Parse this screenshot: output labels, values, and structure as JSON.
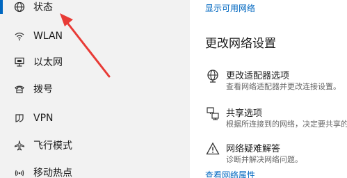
{
  "sidebar": {
    "items": [
      {
        "label": "状态",
        "icon": "globe-icon",
        "active": true
      },
      {
        "label": "WLAN",
        "icon": "wifi-icon"
      },
      {
        "label": "以太网",
        "icon": "ethernet-icon"
      },
      {
        "label": "拨号",
        "icon": "dialup-icon"
      },
      {
        "label": "VPN",
        "icon": "vpn-icon"
      },
      {
        "label": "飞行模式",
        "icon": "airplane-icon"
      },
      {
        "label": "移动热点",
        "icon": "hotspot-icon"
      }
    ]
  },
  "main": {
    "top_link": "显示可用网络",
    "section_title": "更改网络设置",
    "options": [
      {
        "title": "更改适配器选项",
        "desc": "查看网络适配器并更改连接设置。",
        "icon": "adapter-icon"
      },
      {
        "title": "共享选项",
        "desc": "根据所连接到的网络，决定要共享的内容",
        "icon": "sharing-icon"
      },
      {
        "title": "网络疑难解答",
        "desc": "诊断并解决网络问题。",
        "icon": "warning-icon"
      }
    ],
    "bottom_link": "查看网络属性"
  },
  "colors": {
    "accent": "#0067c0",
    "sidebar_bg": "#f2f2f2",
    "annotation_arrow": "#e83b36"
  }
}
